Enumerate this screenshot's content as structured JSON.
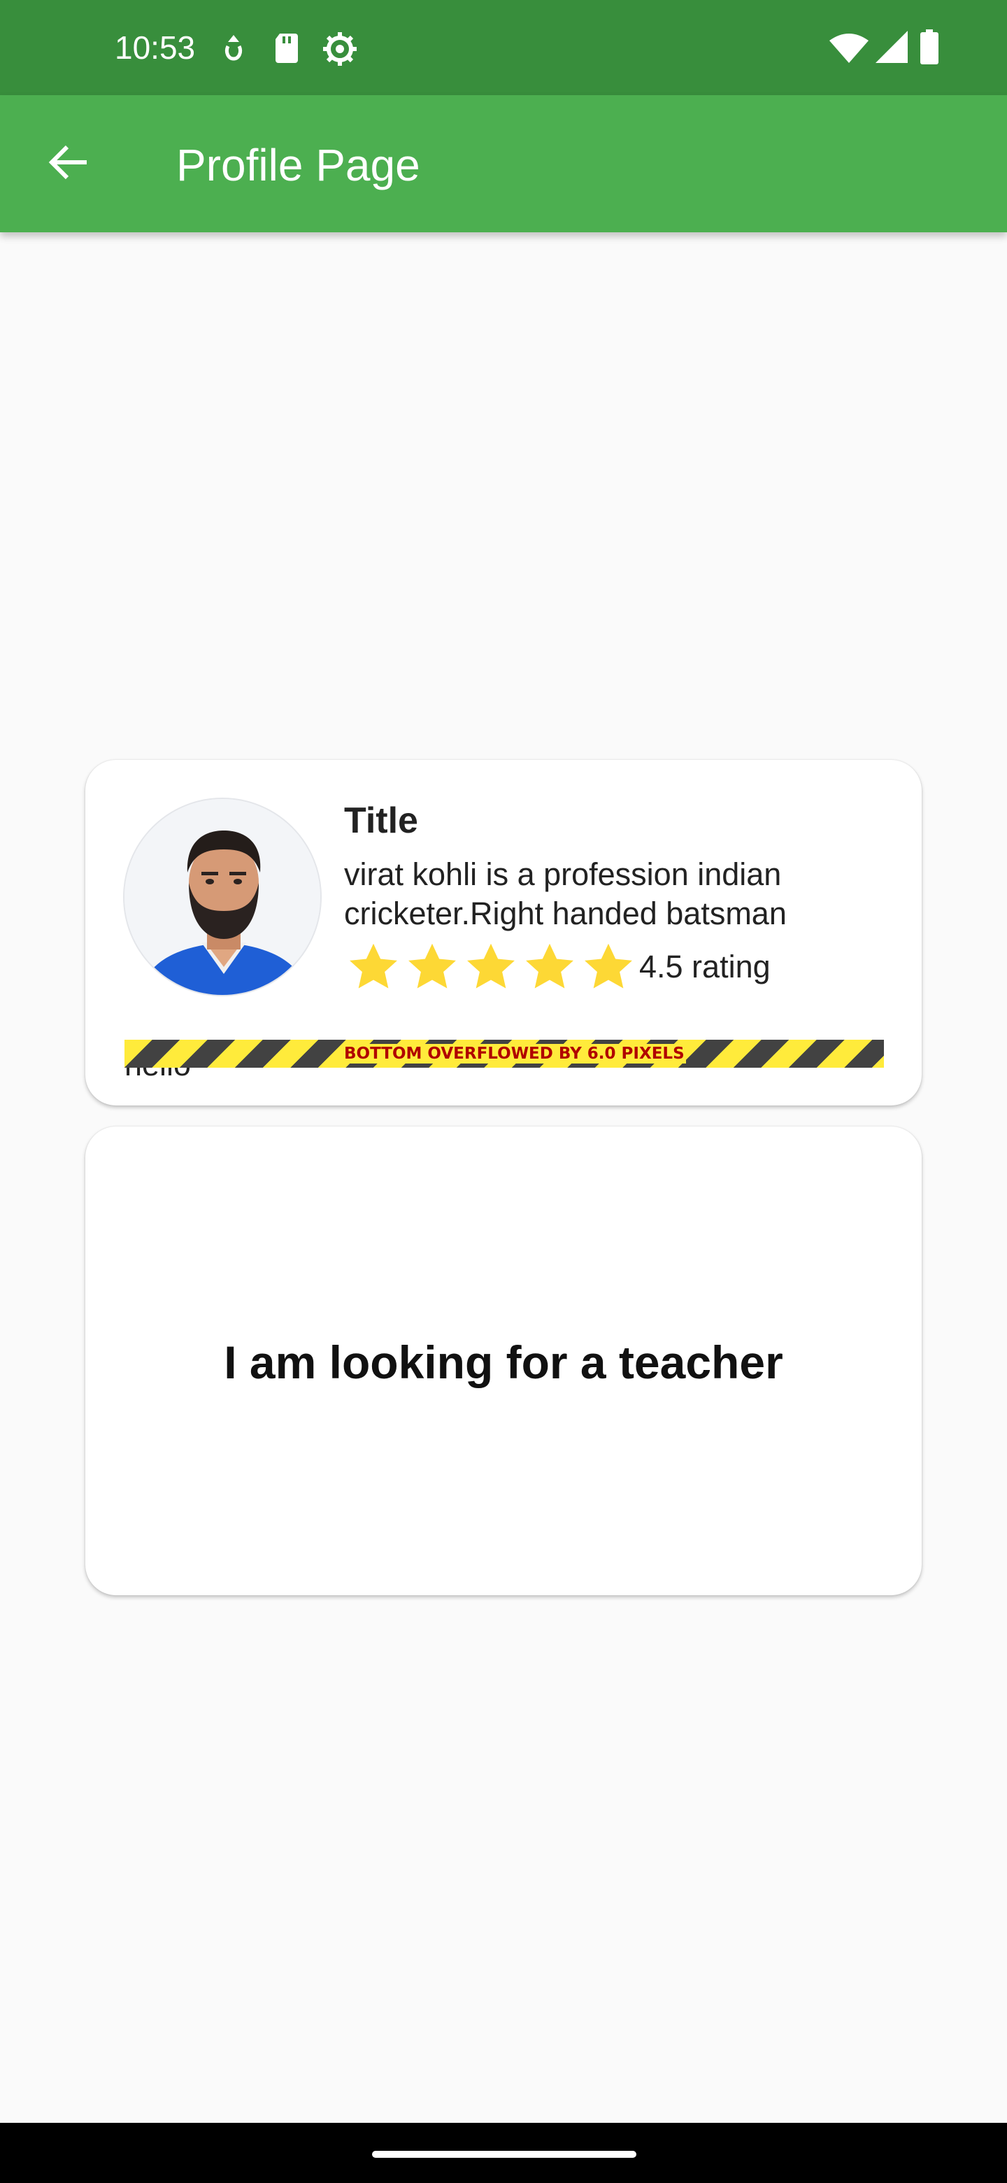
{
  "status_bar": {
    "time": "10:53",
    "icons_left": [
      "data-saver-icon",
      "sd-card-icon",
      "settings-gear-icon"
    ],
    "icons_right": [
      "wifi-icon",
      "cellular-signal-icon",
      "battery-icon"
    ]
  },
  "app_bar": {
    "back_icon": "arrow-back-icon",
    "title": "Profile Page",
    "color": "#4caf50",
    "status_color": "#388e3c"
  },
  "profile_card": {
    "title": "Title",
    "description": "virat kohli is a profession indian cricketer.Right handed batsman",
    "star_icon": "star-icon",
    "stars": 5,
    "star_color": "#fdd835",
    "rating_label": "4.5 rating",
    "footer_text": "hello",
    "overflow_warning": "BOTTOM OVERFLOWED BY 6.0 PIXELS"
  },
  "teacher_card": {
    "text": "I am looking for a teacher"
  }
}
